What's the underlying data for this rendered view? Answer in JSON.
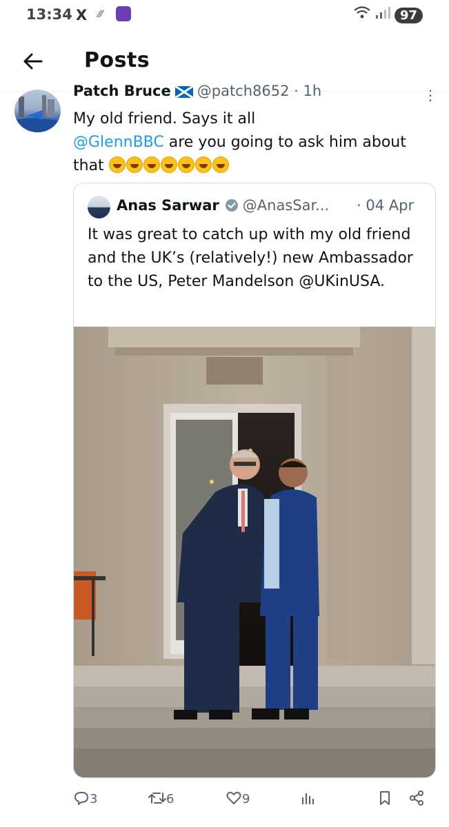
{
  "status_bar": {
    "time": "13:34",
    "x_logo": "X",
    "cast_glyph": "⁄⁄⁄",
    "battery": "97"
  },
  "header": {
    "back_icon": "arrow-left-icon",
    "title": "Posts"
  },
  "tweet": {
    "author_name": "Patch Bruce",
    "handle": "@patch8652",
    "separator": "·",
    "time": "1h",
    "text_line1": "My old friend.  Says it all",
    "mention": "@GlennBBC",
    "text_line2_rest": "  are you going to ask him about",
    "text_line3": "that",
    "emoji_count": 7,
    "quote": {
      "author_name": "Anas Sarwar",
      "handle": "@AnasSar...",
      "date": "· 04 Apr",
      "text": "It was great to catch up with my old friend and the UK’s (relatively!) new Ambassador to the US, Peter Mandelson @UKinUSA."
    },
    "actions": {
      "replies": "3",
      "reposts": "6",
      "likes": "9",
      "views": ""
    }
  },
  "colors": {
    "link": "#1d9bf0",
    "muted": "#536471",
    "border": "#cfd9de"
  }
}
